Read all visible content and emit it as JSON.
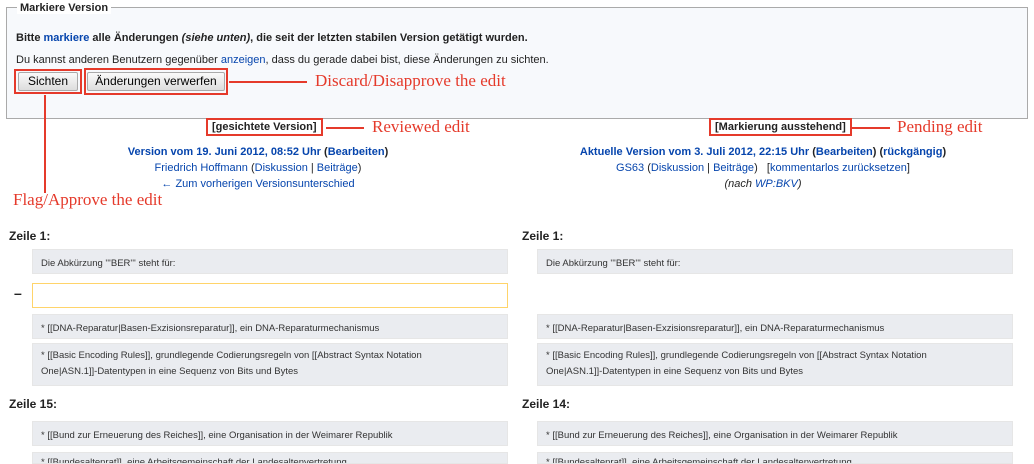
{
  "form": {
    "legend": "Markiere Version",
    "line1_pre": "Bitte ",
    "line1_link": "markiere",
    "line1_mid": " alle Änderungen ",
    "line1_italic": "(siehe unten)",
    "line1_post": ", die seit der letzten stabilen Version getätigt wurden.",
    "line2_pre": "Du kannst anderen Benutzern gegenüber ",
    "line2_link": "anzeigen",
    "line2_post": ", dass du gerade dabei bist, diese Änderungen zu sichten.",
    "btn_sichten": "Sichten",
    "btn_verwerfen": "Änderungen verwerfen"
  },
  "annotations": {
    "discard": "Discard/Disapprove the edit",
    "approve": "Flag/Approve the edit",
    "reviewed": "Reviewed edit",
    "pending": "Pending edit"
  },
  "left": {
    "label": "[gesichtete Version]",
    "version_link": "Version vom 19. Juni 2012, 08:52 Uhr",
    "edit_open": " (",
    "edit_link": "Bearbeiten",
    "edit_close": ")",
    "user": "Friedrich Hoffmann",
    "talk": "Diskussion",
    "contribs": "Beiträge",
    "prev_link": "← Zum vorherigen Versionsunterschied",
    "zeile_a": "Zeile 1:",
    "zeile_b": "Zeile 15:"
  },
  "right": {
    "label": "[Markierung ausstehend]",
    "version_link": "Aktuelle Version vom 3. Juli 2012, 22:15 Uhr",
    "edit_link": "Bearbeiten",
    "undo_link": "rückgängig",
    "user": "GS63",
    "talk": "Diskussion",
    "contribs": "Beiträge",
    "rollback": "kommentarlos zurücksetzen",
    "comment_pre": "(nach ",
    "comment_link": "WP:BKV",
    "comment_post": ")",
    "zeile_a": "Zeile 1:",
    "zeile_b": "Zeile 14:"
  },
  "diff": {
    "minus": "–",
    "row1": "Die Abkürzung '''BER''' steht für:",
    "row2": "* [[DNA-Reparatur|Basen-Exzisionsreparatur]], ein DNA-Reparaturmechanismus",
    "row3a": "* [[Basic Encoding Rules]], grundlegende Codierungsregeln von [[Abstract Syntax Notation",
    "row3b": "One|ASN.1]]-Datentypen in eine Sequenz von Bits und Bytes",
    "row4": "* [[Bund zur Erneuerung des Reiches]], eine Organisation in der Weimarer Republik",
    "row5": "* [[Bundesaltenrat]], eine Arbeitsgemeinschaft der Landesaltenvertretung"
  },
  "colors": {
    "annotation": "#e53a2b",
    "link": "#0645ad",
    "context_bg": "#eaecf0",
    "deleted_border": "#ffd46a"
  }
}
